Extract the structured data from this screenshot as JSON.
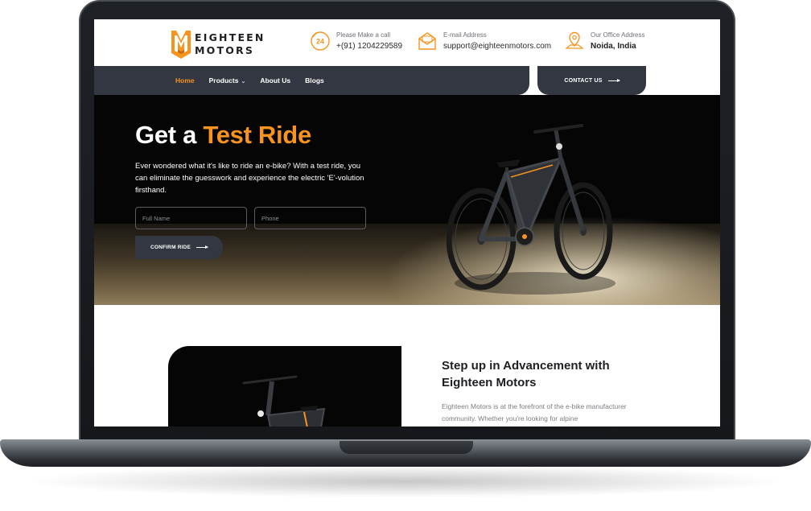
{
  "brand": {
    "line1": "EIGHTEEN",
    "line2": "MOTORS",
    "accent": "#f7931e"
  },
  "contacts": [
    {
      "icon": "phone-24-icon",
      "label": "Please Make a call",
      "value": "+(91) 1204229589"
    },
    {
      "icon": "email-icon",
      "label": "E-mail Address",
      "value": "support@eighteenmotors.com"
    },
    {
      "icon": "location-pin-icon",
      "label": "Our Office Address",
      "value": "Noida, India"
    }
  ],
  "nav": {
    "items": [
      "Home",
      "Products",
      "About Us",
      "Blogs"
    ],
    "active": "Home",
    "contact_label": "CONTACT US"
  },
  "hero": {
    "title_white": "Get a",
    "title_accent": "Test Ride",
    "description": "Ever wondered what it's like to ride an e-bike? With a test ride, you can eliminate the guesswork and experience the electric 'E'-volution firsthand.",
    "name_placeholder": "Full Name",
    "phone_placeholder": "Phone",
    "confirm_label": "CONFIRM RIDE"
  },
  "section2": {
    "title": "Step up in Advancement with Eighteen Motors",
    "body": "Eighteen Motors is at the forefront of the e-bike manufacturer community. Whether you're looking for alpine"
  },
  "colors": {
    "dark_nav": "#333741",
    "accent": "#f7931e",
    "hero_bg": "#050505"
  }
}
